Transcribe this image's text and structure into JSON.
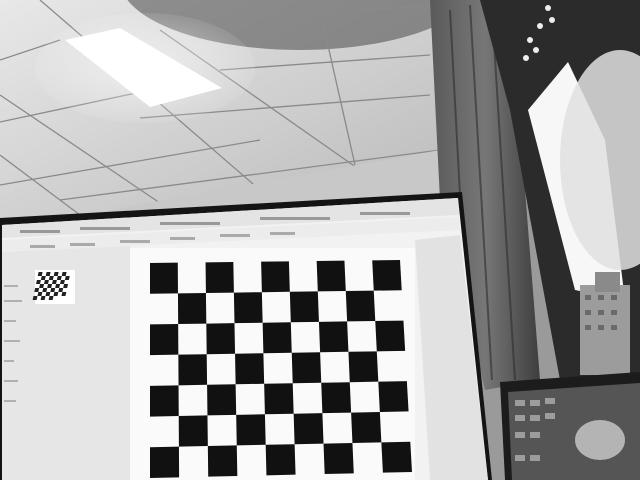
{
  "scene": {
    "description_tags": [
      "monitor",
      "checkerboard",
      "office-ceiling",
      "window",
      "laptop"
    ],
    "colors": {
      "ceiling": "#d9d9d9",
      "ceiling_grid": "#8a8a8a",
      "light_panel": "#ffffff",
      "wall": "#cfcfcf",
      "monitor_bezel": "#141414",
      "screen_bg": "#f2f2f2",
      "checker_dark": "#111111",
      "window_frame": "#2b2b2b",
      "window_glass": "#f7f7f7",
      "laptop": "#1c1c1c"
    }
  },
  "checkerboard": {
    "rows": 7,
    "cols": 9
  }
}
